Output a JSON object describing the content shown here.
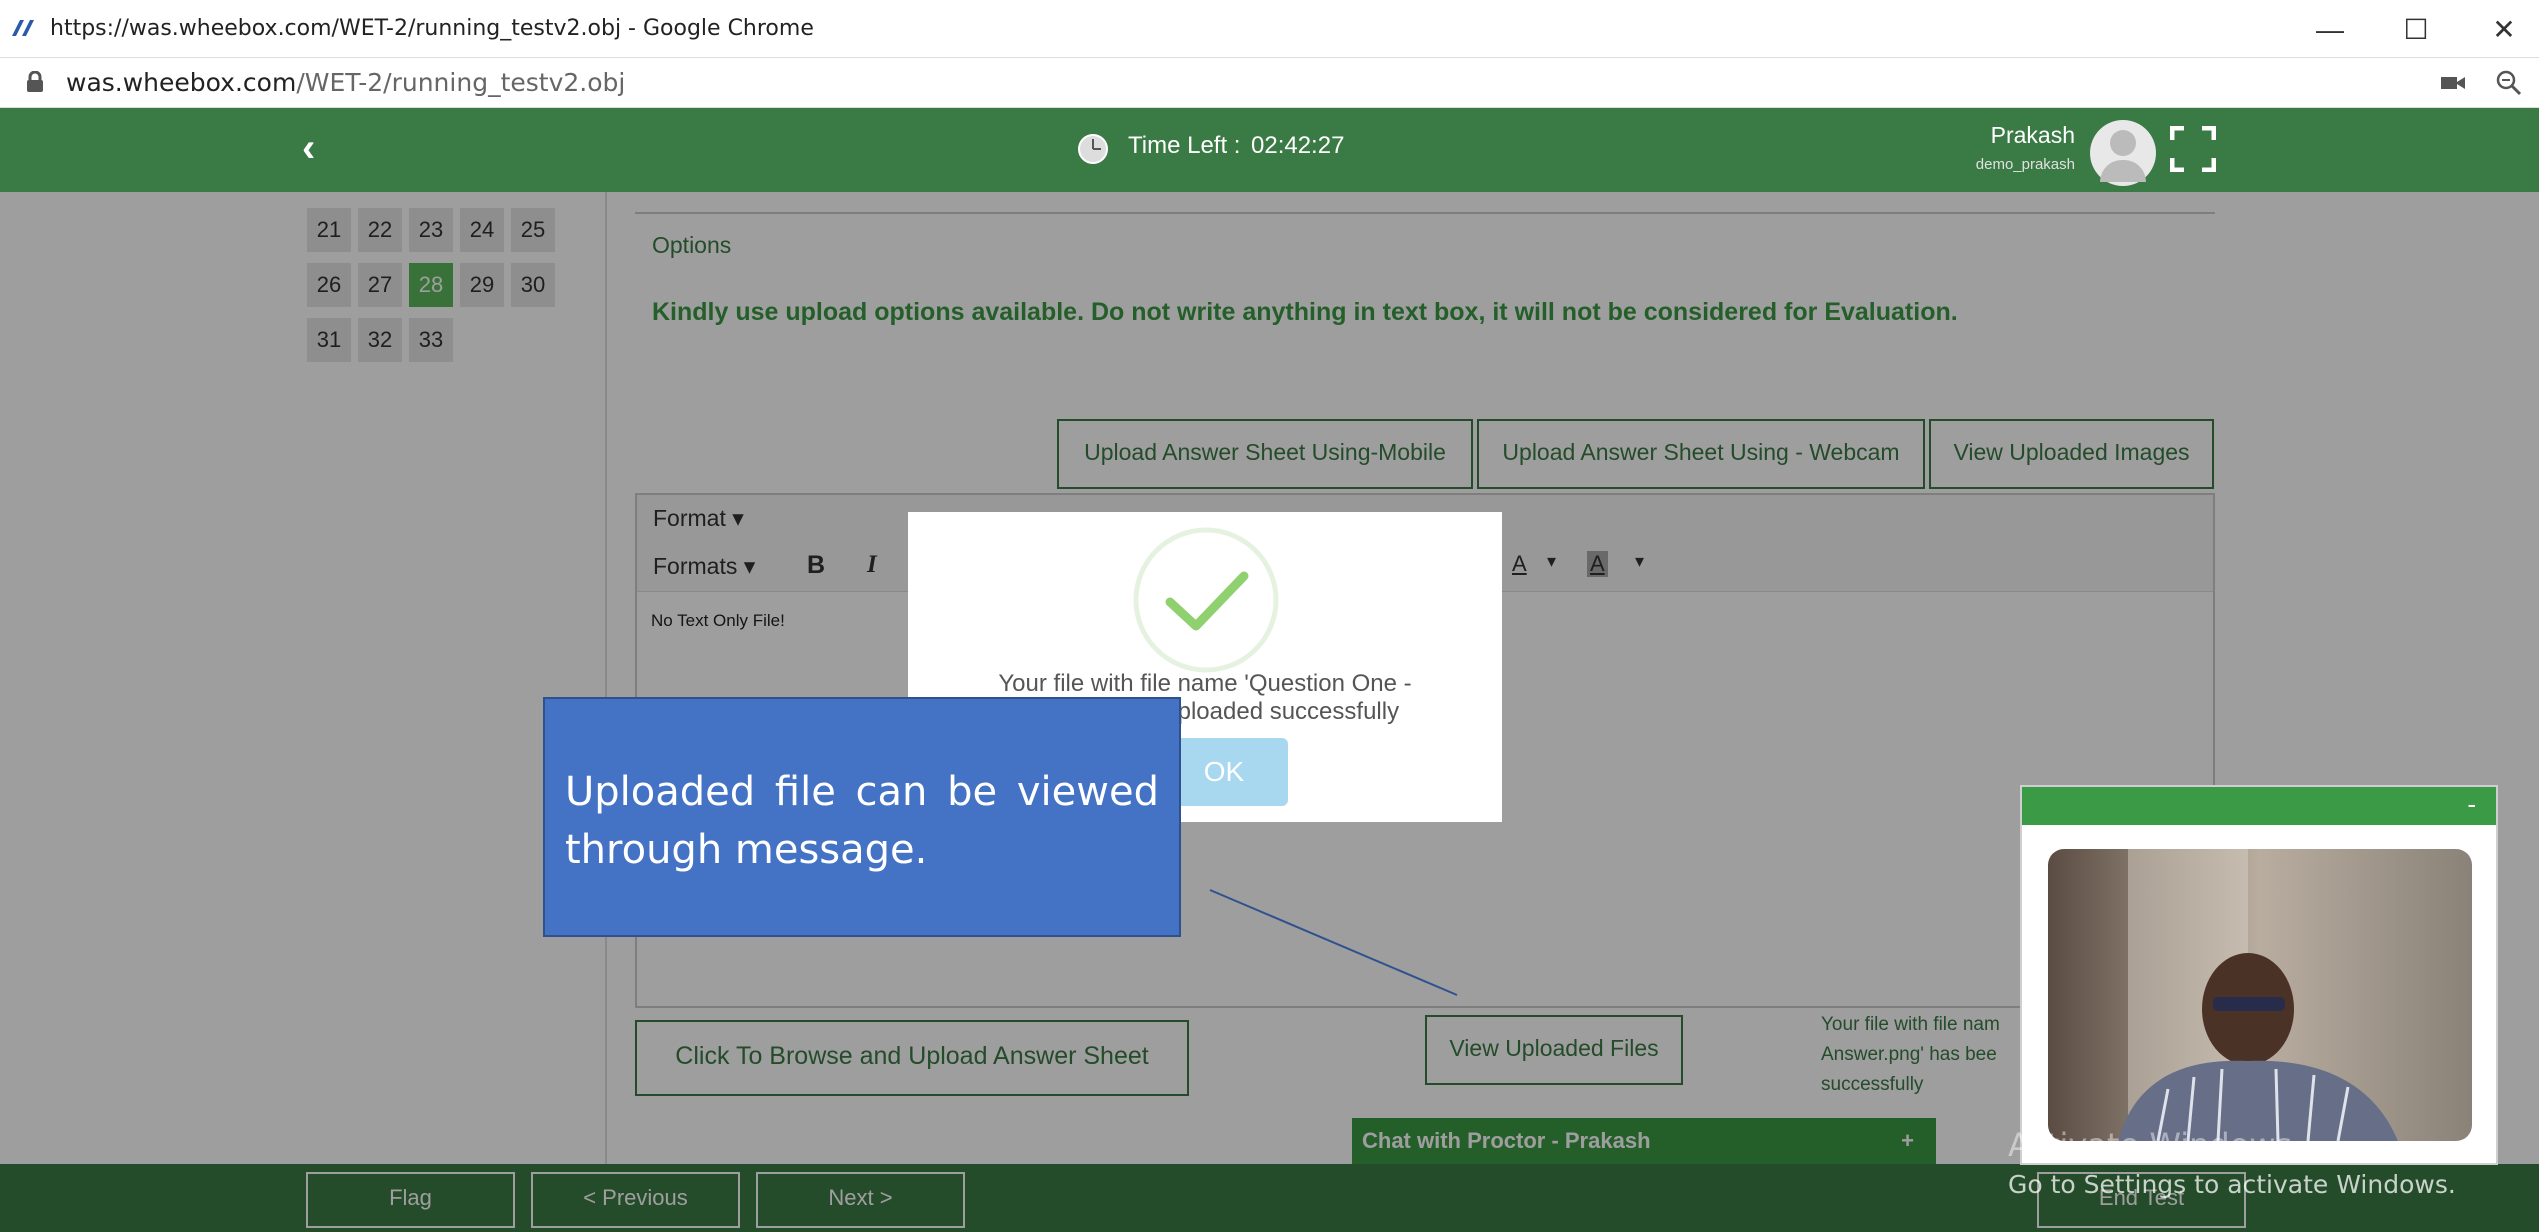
{
  "browser": {
    "title": "https://was.wheebox.com/WET-2/running_testv2.obj - Google Chrome",
    "url_host": "was.wheebox.com",
    "url_path": "/WET-2/running_testv2.obj",
    "minimize": "—",
    "maximize": "☐",
    "close": "✕"
  },
  "header": {
    "back_icon": "chevron-left-icon",
    "timer_label": "Time Left :",
    "timer_value": "02:42:27",
    "user_name": "Prakash",
    "user_id": "demo_prakash"
  },
  "question_grid": {
    "rows": [
      [
        "21",
        "22",
        "23",
        "24",
        "25"
      ],
      [
        "26",
        "27",
        "28",
        "29",
        "30"
      ],
      [
        "31",
        "32",
        "33"
      ]
    ],
    "active": "28"
  },
  "main": {
    "options_label": "Options",
    "instruction": "Kindly use upload options available. Do not write anything in text box, it will not be considered for Evaluation.",
    "upload_mobile": "Upload Answer Sheet Using-Mobile",
    "upload_webcam": "Upload Answer Sheet Using - Webcam",
    "view_images": "View Uploaded Images",
    "format_menu": "Format",
    "formats_menu": "Formats",
    "bold": "B",
    "italic": "I",
    "text_color": "A",
    "bg_color": "A",
    "editor_text": "No Text Only File!",
    "browse_upload": "Click To Browse and Upload Answer Sheet",
    "view_files": "View Uploaded Files",
    "status_line1": "Your file with file nam",
    "status_line2": "Answer.png' has bee",
    "status_line3": "successfully"
  },
  "chat": {
    "label": "Chat with Proctor - Prakash",
    "plus": "+"
  },
  "webcam": {
    "minimize": "-"
  },
  "footer": {
    "flag": "Flag",
    "previous": "< Previous",
    "next": "Next >",
    "end": "End Test"
  },
  "modal": {
    "line1": "Your file with file name 'Question One -",
    "line2": "en uploaded successfully",
    "ok": "OK"
  },
  "callout": {
    "text": "Uploaded file can be viewed through message."
  },
  "watermark": {
    "line1": "Activate Windows",
    "line2": "Go to Settings to activate Windows."
  },
  "colors": {
    "brand_green": "#3a7a45",
    "active_question": "#5cb85c",
    "callout_blue": "#4472c4"
  }
}
